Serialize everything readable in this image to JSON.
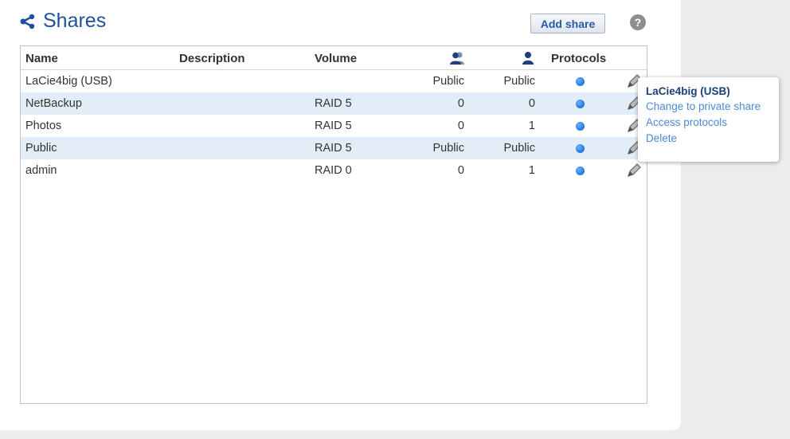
{
  "page": {
    "title": "Shares"
  },
  "toolbar": {
    "add_share_label": "Add share",
    "help_label": "?"
  },
  "table": {
    "columns": {
      "name": "Name",
      "description": "Description",
      "volume": "Volume",
      "protocols": "Protocols"
    },
    "rows": [
      {
        "name": "LaCie4big (USB)",
        "description": "",
        "volume": "",
        "groups": "Public",
        "users": "Public"
      },
      {
        "name": "NetBackup",
        "description": "",
        "volume": "RAID 5",
        "groups": "0",
        "users": "0"
      },
      {
        "name": "Photos",
        "description": "",
        "volume": "RAID 5",
        "groups": "0",
        "users": "1"
      },
      {
        "name": "Public",
        "description": "",
        "volume": "RAID 5",
        "groups": "Public",
        "users": "Public"
      },
      {
        "name": "admin",
        "description": "",
        "volume": "RAID 0",
        "groups": "0",
        "users": "1"
      }
    ]
  },
  "context_menu": {
    "title": "LaCie4big (USB)",
    "items": [
      "Change to private share",
      "Access protocols",
      "Delete"
    ]
  },
  "colors": {
    "title": "#1f4f9c",
    "row_alt": "#e3edf7",
    "link": "#4a8ad6",
    "protocol_dot": "#1f74e0"
  },
  "icons": {
    "title": "share-icon",
    "groups": "group-icon",
    "users": "user-icon",
    "edit": "pencil-icon",
    "help": "help-icon"
  }
}
